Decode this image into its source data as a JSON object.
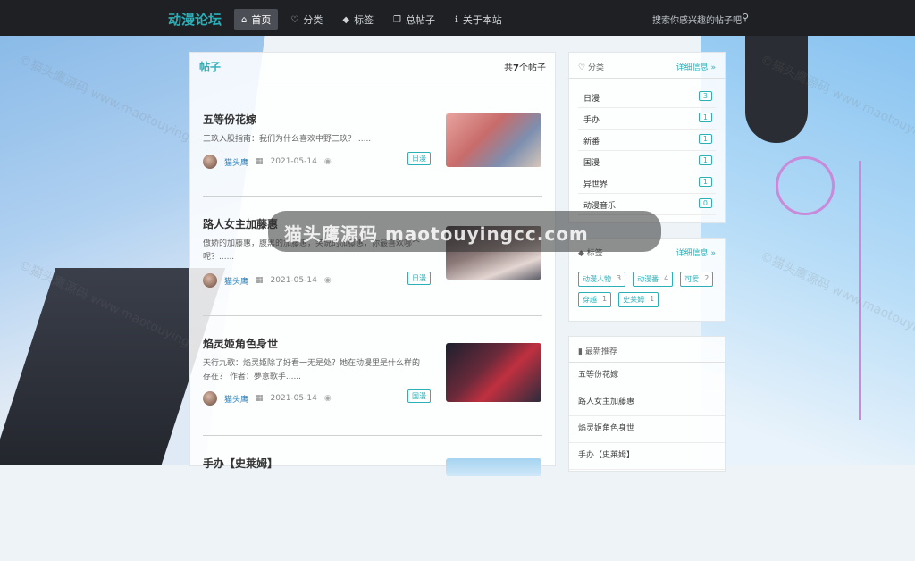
{
  "header": {
    "brand": "动漫论坛",
    "nav": [
      {
        "icon": "home-icon",
        "glyph": "⌂",
        "label": "首页"
      },
      {
        "icon": "bulb-icon",
        "glyph": "♡",
        "label": "分类"
      },
      {
        "icon": "tag-icon",
        "glyph": "◆",
        "label": "标签"
      },
      {
        "icon": "copy-icon",
        "glyph": "❐",
        "label": "总帖子"
      },
      {
        "icon": "info-icon",
        "glyph": "ℹ",
        "label": "关于本站"
      }
    ],
    "search_placeholder": "搜索你感兴趣的帖子吧"
  },
  "main": {
    "title": "帖子",
    "count_prefix": "共",
    "count_num": "7",
    "count_suffix": "个帖子",
    "posts": [
      {
        "title": "五等份花嫁",
        "excerpt": "三玖入股指南：我们为什么喜欢中野三玖？......",
        "author": "猫头鹰",
        "date": "2021-05-14",
        "tag": "日漫"
      },
      {
        "title": "路人女主加藤惠",
        "excerpt": "傲娇的加藤惠，腹黑的加藤惠，笑说的加藤惠，你最喜欢哪个呢？......",
        "author": "猫头鹰",
        "date": "2021-05-14",
        "tag": "日漫"
      },
      {
        "title": "焰灵姬角色身世",
        "excerpt": "天行九歌：焰灵姬除了好看一无是处？她在动漫里是什么样的存在？ 作者：夢意歌手......",
        "author": "猫头鹰",
        "date": "2021-05-14",
        "tag": "国漫"
      },
      {
        "title": "手办【史莱姆】",
        "excerpt": "",
        "author": "",
        "date": "",
        "tag": ""
      }
    ]
  },
  "categories": {
    "title": "分类",
    "more": "详细信息 »",
    "items": [
      {
        "name": "日漫",
        "count": "3"
      },
      {
        "name": "手办",
        "count": "1"
      },
      {
        "name": "新番",
        "count": "1"
      },
      {
        "name": "国漫",
        "count": "1"
      },
      {
        "name": "异世界",
        "count": "1"
      },
      {
        "name": "动漫音乐",
        "count": "0"
      }
    ]
  },
  "tags": {
    "title": "标签",
    "more": "详细信息 »",
    "items": [
      {
        "name": "动漫人物",
        "count": "3"
      },
      {
        "name": "动漫番",
        "count": "4"
      },
      {
        "name": "可爱",
        "count": "2"
      },
      {
        "name": "穿越",
        "count": "1"
      },
      {
        "name": "史莱姆",
        "count": "1"
      }
    ]
  },
  "recommend": {
    "title": "最新推荐",
    "items": [
      "五等份花嫁",
      "路人女主加藤惠",
      "焰灵姬角色身世",
      "手办【史莱姆】"
    ]
  },
  "overlay": "猫头鹰源码 maotouyingcc.com",
  "watermark": "©猫头鹰源码 www.maotouyingcc.com",
  "colors": {
    "accent": "#2bb0b8",
    "topbar": "#1e2024"
  }
}
